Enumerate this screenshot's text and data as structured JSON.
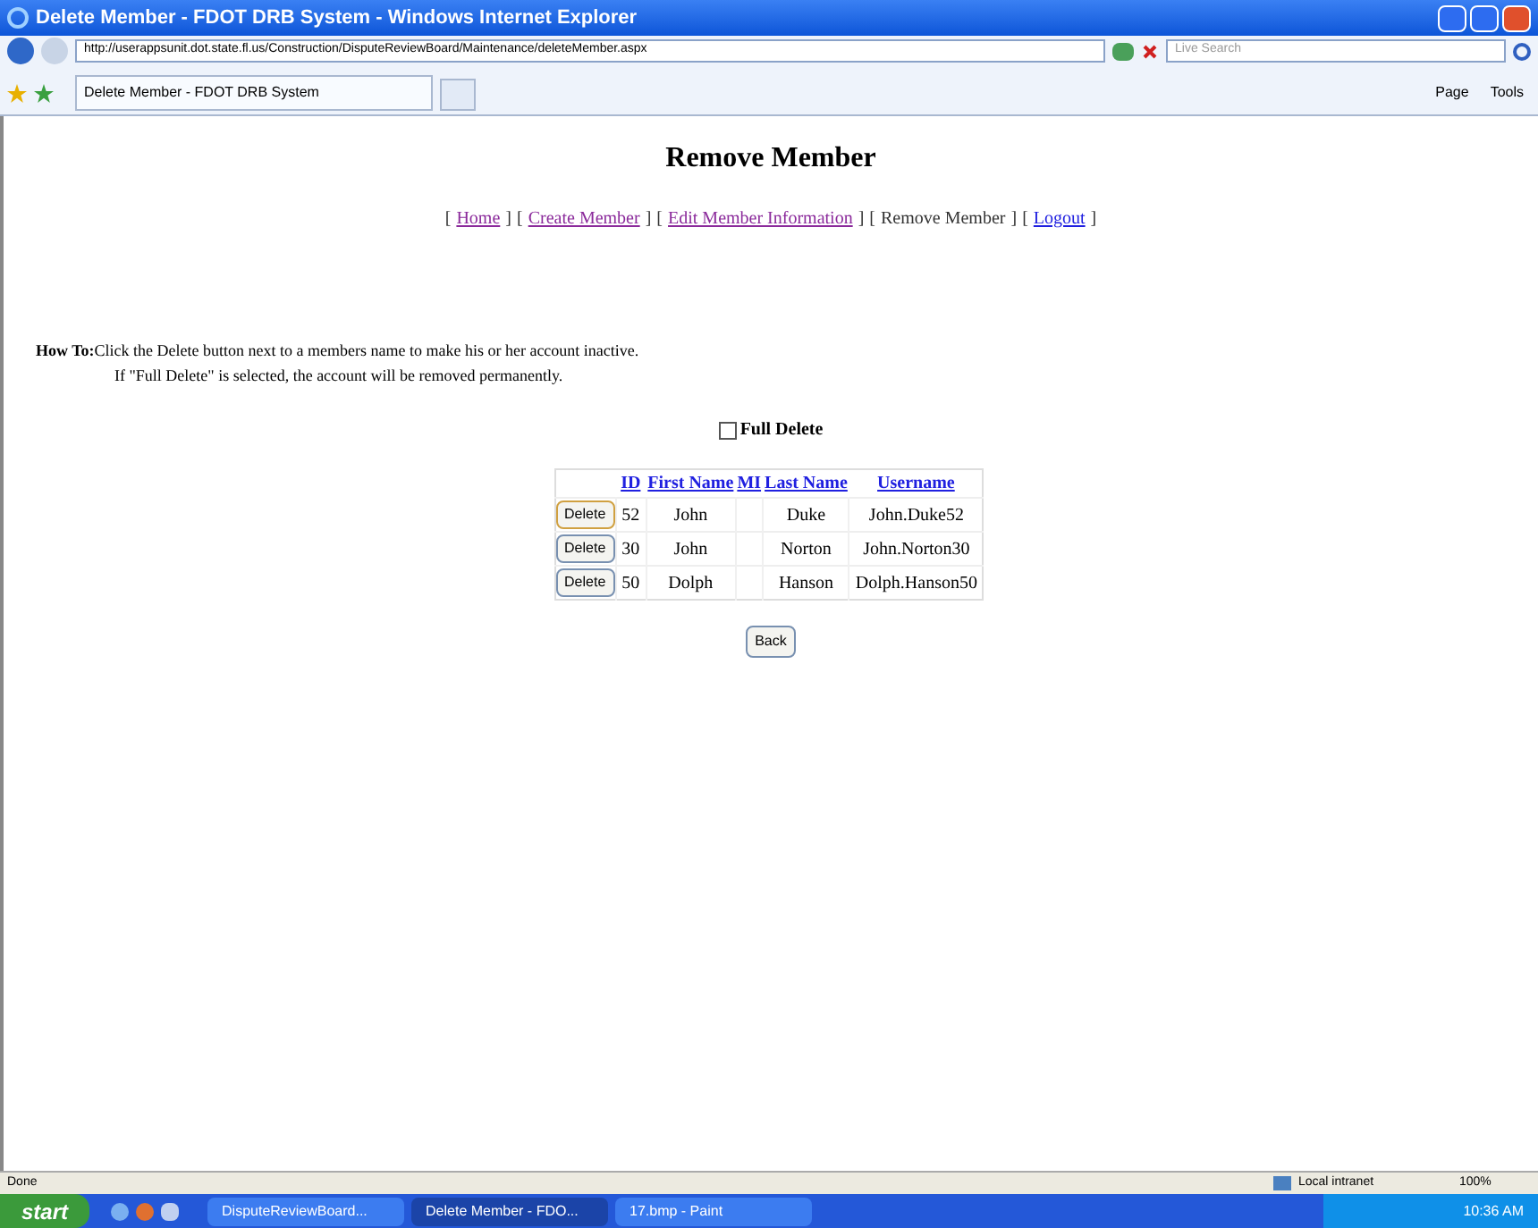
{
  "window": {
    "title": "Delete Member - FDOT DRB System - Windows Internet Explorer"
  },
  "address_bar": {
    "url": "http://userappsunit.dot.state.fl.us/Construction/DisputeReviewBoard/Maintenance/deleteMember.aspx"
  },
  "search": {
    "placeholder": "Live Search"
  },
  "tabs": [
    {
      "label": "Delete Member - FDOT DRB System",
      "selected": true
    }
  ],
  "command_bar": [
    "Page",
    "Tools"
  ],
  "page": {
    "heading": "Remove Member",
    "nav": [
      {
        "open": "[",
        "label": "Home",
        "close": "]",
        "kind": "link",
        "visited": true
      },
      {
        "open": "[",
        "label": "Create Member",
        "close": "]",
        "kind": "link",
        "visited": true
      },
      {
        "open": "[",
        "label": "Edit Member Information",
        "close": "]",
        "kind": "link",
        "visited": true
      },
      {
        "open": "[",
        "label": "Remove Member",
        "close": "]",
        "kind": "current"
      },
      {
        "open": "[",
        "label": "Logout",
        "close": "]",
        "kind": "link",
        "visited": false
      }
    ],
    "howto_label": "How To:",
    "howto_line1": "Click the Delete button next to a members name to make his or her account inactive.",
    "howto_line2": "If \"Full Delete\" is selected, the account will be removed permanently.",
    "full_delete": {
      "label": "Full Delete",
      "checked": false
    },
    "table": {
      "columns": [
        "ID",
        "First Name",
        "MI",
        "Last Name",
        "Username"
      ],
      "rows": [
        {
          "button": "Delete",
          "focused": true,
          "cells": [
            "52",
            "John",
            "",
            "Duke",
            "John.Duke52"
          ]
        },
        {
          "button": "Delete",
          "focused": false,
          "cells": [
            "30",
            "John",
            "",
            "Norton",
            "John.Norton30"
          ]
        },
        {
          "button": "Delete",
          "focused": false,
          "cells": [
            "50",
            "Dolph",
            "",
            "Hanson",
            "Dolph.Hanson50"
          ]
        }
      ]
    },
    "back_button": "Back"
  },
  "status_bar": {
    "text": "Done",
    "zone": "Local intranet",
    "zoom": "100%"
  },
  "taskbar": {
    "start": "start",
    "items": [
      {
        "label": "DisputeReviewBoard...",
        "selected": false
      },
      {
        "label": "Delete Member - FDO...",
        "selected": true
      },
      {
        "label": "17.bmp - Paint",
        "selected": false
      }
    ],
    "clock": "10:36 AM"
  }
}
